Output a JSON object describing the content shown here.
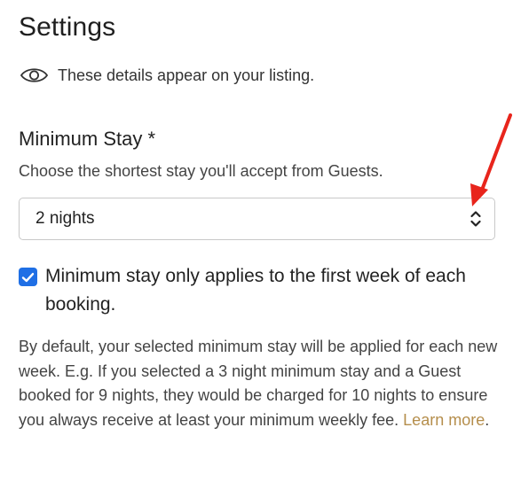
{
  "header": {
    "title": "Settings"
  },
  "notice": {
    "icon": "eye-icon",
    "text": "These details appear on your listing."
  },
  "minimum_stay": {
    "label": "Minimum Stay *",
    "help": "Choose the shortest stay you'll accept from Guests.",
    "selected_value": "2 nights",
    "dropdown_icon": "chevron-up-down-icon"
  },
  "first_week_option": {
    "checked": true,
    "label": "Minimum stay only applies to the first week of each booking."
  },
  "description": {
    "text": "By default, your selected minimum stay will be applied for each new week. E.g. If you selected a 3 night minimum stay and a Guest booked for 9 nights, they would be charged for 10 nights to ensure you always receive at least your minimum weekly fee. ",
    "link_text": "Learn more",
    "trailing": "."
  },
  "annotation": {
    "icon": "red-arrow-icon",
    "color": "#e8251c"
  },
  "colors": {
    "checkbox": "#1f6fe5",
    "link": "#b58e4c",
    "border": "#c8c8c8"
  }
}
